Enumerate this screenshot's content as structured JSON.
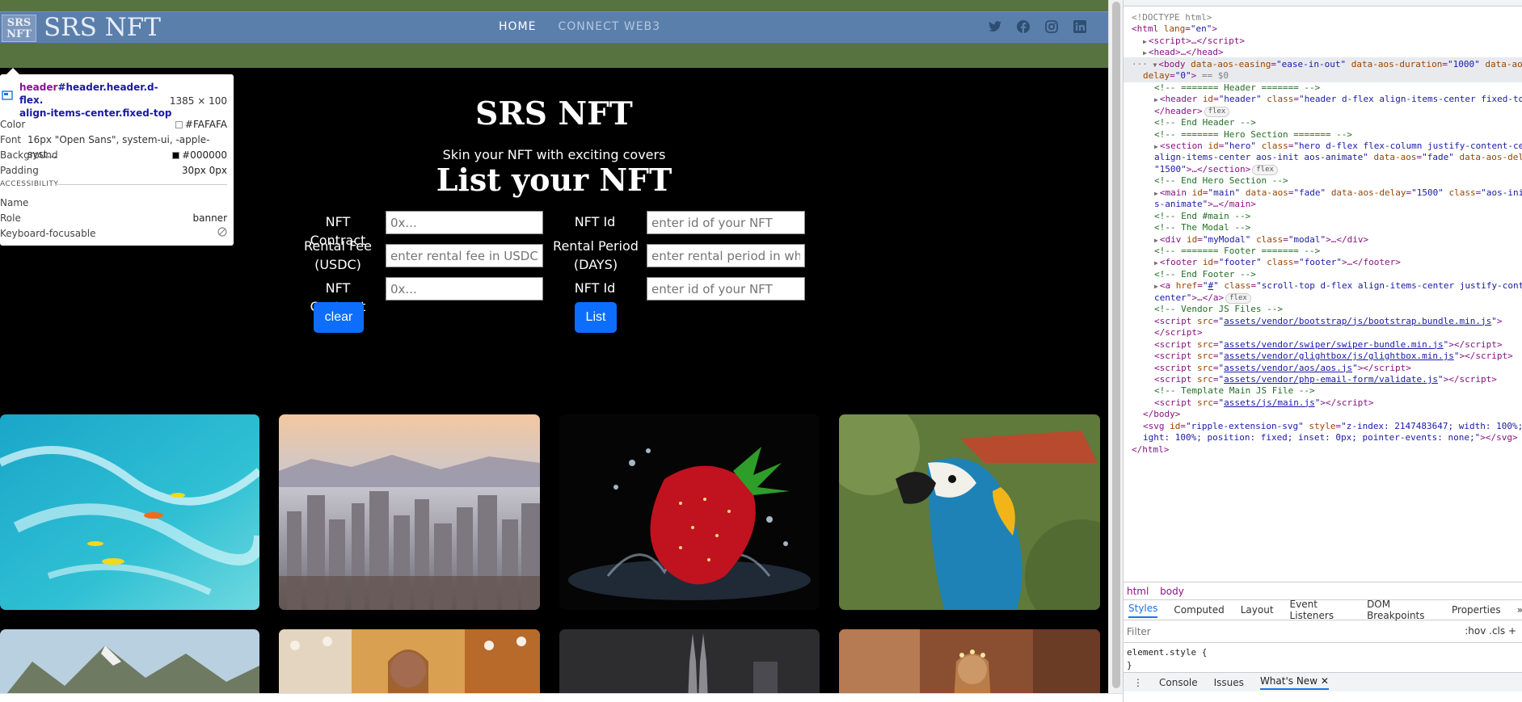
{
  "site": {
    "logo_mark": "SRS NFT",
    "name": "SRS NFT",
    "nav": [
      {
        "label": "HOME",
        "active": true
      },
      {
        "label": "CONNECT WEB3",
        "active": false
      }
    ],
    "socials": [
      "twitter-icon",
      "facebook-icon",
      "instagram-icon",
      "linkedin-icon"
    ]
  },
  "tooltip": {
    "selector_tag": "header",
    "selector_rest": "#header.header.d-flex.",
    "selector_line2": "align-items-center.fixed-top",
    "size": "1385 × 100",
    "rows": [
      {
        "k": "Color",
        "v": "#FAFAFA",
        "swatch": "#fafafa"
      },
      {
        "k": "Font",
        "v": "16px \"Open Sans\", system-ui, -apple-syst…",
        "swatch": ""
      },
      {
        "k": "Background",
        "v": "#000000",
        "swatch": "#000000"
      },
      {
        "k": "Padding",
        "v": "30px 0px",
        "swatch": ""
      }
    ],
    "accessibility_heading": "ACCESSIBILITY",
    "acc_rows": [
      {
        "k": "Name",
        "v": ""
      },
      {
        "k": "Role",
        "v": "banner"
      },
      {
        "k": "Keyboard-focusable",
        "v": ""
      }
    ]
  },
  "hero": {
    "title": "SRS NFT",
    "subtitle": "Skin your NFT with exciting covers",
    "form_title": "List your NFT"
  },
  "form": {
    "label_nft_contract": "NFT Contract",
    "label_nft_id": "NFT Id",
    "label_rental_fee": "Rental Fee (USDC)",
    "label_rental_period": "Rental Period (DAYS)",
    "label_nft_contract_2": "NFT Contract",
    "label_nft_id_2": "NFT Id",
    "placeholder_contract": "0x...",
    "placeholder_id": "enter id of your NFT",
    "placeholder_fee": "enter rental fee in USDC",
    "placeholder_period": "enter rental period in wh",
    "placeholder_contract_2": "0x...",
    "placeholder_id_2": "enter id of your NFT",
    "clear_label": "clear",
    "list_label": "List"
  },
  "gallery": [
    "surfers",
    "city-skyline",
    "strawberry-splash",
    "macaw-parrot",
    "mountains",
    "fashion-model",
    "twin-towers",
    "woman-forest"
  ],
  "devtools": {
    "lines": [
      {
        "i": 0,
        "html": "<span class='t-gray'>&lt;!DOCTYPE html&gt;</span>"
      },
      {
        "i": 0,
        "html": "<span class='t-tag'>&lt;html</span> <span class='t-attr'>lang</span>=<span class='t-val'>\"en\"</span><span class='t-tag'>&gt;</span>"
      },
      {
        "i": 1,
        "html": "<span class='tri'>▶</span><span class='t-tag'>&lt;script&gt;</span>…<span class='t-tag'>&lt;/script&gt;</span>"
      },
      {
        "i": 1,
        "html": "<span class='tri'>▶</span><span class='t-tag'>&lt;head&gt;</span>…<span class='t-tag'>&lt;/head&gt;</span>"
      },
      {
        "i": 0,
        "sel": true,
        "html": "<span class='t-gray'>··· </span><span class='tri'>▼</span><span class='t-tag'>&lt;body</span> <span class='t-attr'>data-aos-easing</span>=<span class='t-val'>\"ease-in-out\"</span> <span class='t-attr'>data-aos-duration</span>=<span class='t-val'>\"1000\"</span> <span class='t-attr'>data-aos-</span>"
      },
      {
        "i": 1,
        "sel": true,
        "html": "<span class='t-attr'>delay</span>=<span class='t-val'>\"0\"</span><span class='t-tag'>&gt;</span> <span class='t-gray'>== $0</span>"
      },
      {
        "i": 2,
        "html": "<span class='t-cmt'>&lt;!-- ======= Header ======= --&gt;</span>"
      },
      {
        "i": 2,
        "html": "<span class='tri'>▶</span><span class='t-tag'>&lt;header</span> <span class='t-attr'>id</span>=<span class='t-val'>\"header\"</span> <span class='t-attr'>class</span>=<span class='t-val'>\"header d-flex align-items-center fixed-top</span>"
      },
      {
        "i": 2,
        "html": "<span class='t-tag'>&lt;/header&gt;</span><span class='badge'>flex</span>"
      },
      {
        "i": 2,
        "html": "<span class='t-cmt'>&lt;!-- End Header --&gt;</span>"
      },
      {
        "i": 2,
        "html": "<span class='t-cmt'>&lt;!-- ======= Hero Section ======= --&gt;</span>"
      },
      {
        "i": 2,
        "html": "<span class='tri'>▶</span><span class='t-tag'>&lt;section</span> <span class='t-attr'>id</span>=<span class='t-val'>\"hero\"</span> <span class='t-attr'>class</span>=<span class='t-val'>\"hero d-flex flex-column justify-content-cen</span>"
      },
      {
        "i": 2,
        "html": "<span class='t-val'>align-items-center aos-init aos-animate\"</span> <span class='t-attr'>data-aos</span>=<span class='t-val'>\"fade\"</span> <span class='t-attr'>data-aos-del</span>"
      },
      {
        "i": 2,
        "html": "<span class='t-val'>\"1500\"</span><span class='t-tag'>&gt;</span>…<span class='t-tag'>&lt;/section&gt;</span><span class='badge'>flex</span>"
      },
      {
        "i": 2,
        "html": "<span class='t-cmt'>&lt;!-- End Hero Section --&gt;</span>"
      },
      {
        "i": 2,
        "html": "<span class='tri'>▶</span><span class='t-tag'>&lt;main</span> <span class='t-attr'>id</span>=<span class='t-val'>\"main\"</span> <span class='t-attr'>data-aos</span>=<span class='t-val'>\"fade\"</span> <span class='t-attr'>data-aos-delay</span>=<span class='t-val'>\"1500\"</span> <span class='t-attr'>class</span>=<span class='t-val'>\"aos-init</span>"
      },
      {
        "i": 2,
        "html": "<span class='t-val'>s-animate\"</span><span class='t-tag'>&gt;</span>…<span class='t-tag'>&lt;/main&gt;</span>"
      },
      {
        "i": 2,
        "html": "<span class='t-cmt'>&lt;!-- End #main --&gt;</span>"
      },
      {
        "i": 2,
        "html": "<span class='t-cmt'>&lt;!-- The Modal --&gt;</span>"
      },
      {
        "i": 2,
        "html": "<span class='tri'>▶</span><span class='t-tag'>&lt;div</span> <span class='t-attr'>id</span>=<span class='t-val'>\"myModal\"</span> <span class='t-attr'>class</span>=<span class='t-val'>\"modal\"</span><span class='t-tag'>&gt;</span>…<span class='t-tag'>&lt;/div&gt;</span>"
      },
      {
        "i": 2,
        "html": "<span class='t-cmt'>&lt;!-- ======= Footer ======= --&gt;</span>"
      },
      {
        "i": 2,
        "html": "<span class='tri'>▶</span><span class='t-tag'>&lt;footer</span> <span class='t-attr'>id</span>=<span class='t-val'>\"footer\"</span> <span class='t-attr'>class</span>=<span class='t-val'>\"footer\"</span><span class='t-tag'>&gt;</span>…<span class='t-tag'>&lt;/footer&gt;</span>"
      },
      {
        "i": 2,
        "html": "<span class='t-cmt'>&lt;!-- End Footer --&gt;</span>"
      },
      {
        "i": 2,
        "html": "<span class='tri'>▶</span><span class='t-tag'>&lt;a</span> <span class='t-attr'>href</span>=<span class='t-val'>\"<span class='t-link'>#</span>\"</span> <span class='t-attr'>class</span>=<span class='t-val'>\"scroll-top d-flex align-items-center justify-conte</span>"
      },
      {
        "i": 2,
        "html": "<span class='t-val'>center\"</span><span class='t-tag'>&gt;</span>…<span class='t-tag'>&lt;/a&gt;</span><span class='badge'>flex</span>"
      },
      {
        "i": 2,
        "html": "<span class='t-cmt'>&lt;!-- Vendor JS Files --&gt;</span>"
      },
      {
        "i": 2,
        "html": "<span class='t-tag'>&lt;script</span> <span class='t-attr'>src</span>=<span class='t-val'>\"<span class='t-link'>assets/vendor/bootstrap/js/bootstrap.bundle.min.js</span>\"</span><span class='t-tag'>&gt;</span>"
      },
      {
        "i": 2,
        "html": "<span class='t-tag'>&lt;/script&gt;</span>"
      },
      {
        "i": 2,
        "html": "<span class='t-tag'>&lt;script</span> <span class='t-attr'>src</span>=<span class='t-val'>\"<span class='t-link'>assets/vendor/swiper/swiper-bundle.min.js</span>\"</span><span class='t-tag'>&gt;&lt;/script&gt;</span>"
      },
      {
        "i": 2,
        "html": "<span class='t-tag'>&lt;script</span> <span class='t-attr'>src</span>=<span class='t-val'>\"<span class='t-link'>assets/vendor/glightbox/js/glightbox.min.js</span>\"</span><span class='t-tag'>&gt;&lt;/script&gt;</span>"
      },
      {
        "i": 2,
        "html": "<span class='t-tag'>&lt;script</span> <span class='t-attr'>src</span>=<span class='t-val'>\"<span class='t-link'>assets/vendor/aos/aos.js</span>\"</span><span class='t-tag'>&gt;&lt;/script&gt;</span>"
      },
      {
        "i": 2,
        "html": "<span class='t-tag'>&lt;script</span> <span class='t-attr'>src</span>=<span class='t-val'>\"<span class='t-link'>assets/vendor/php-email-form/validate.js</span>\"</span><span class='t-tag'>&gt;&lt;/script&gt;</span>"
      },
      {
        "i": 2,
        "html": "<span class='t-cmt'>&lt;!-- Template Main JS File --&gt;</span>"
      },
      {
        "i": 2,
        "html": "<span class='t-tag'>&lt;script</span> <span class='t-attr'>src</span>=<span class='t-val'>\"<span class='t-link'>assets/js/main.js</span>\"</span><span class='t-tag'>&gt;&lt;/script&gt;</span>"
      },
      {
        "i": 1,
        "html": "<span class='t-tag'>&lt;/body&gt;</span>"
      },
      {
        "i": 1,
        "html": "<span class='t-tag'>&lt;svg</span> <span class='t-attr'>id</span>=<span class='t-val'>\"ripple-extension-svg\"</span> <span class='t-attr'>style</span>=<span class='t-val'>\"z-index: 2147483647; width: 100%;</span>"
      },
      {
        "i": 1,
        "html": "<span class='t-val'>ight: 100%; position: fixed; inset: 0px; pointer-events: none;\"</span><span class='t-tag'>&gt;&lt;/svg&gt;</span>"
      },
      {
        "i": 0,
        "html": "<span class='t-tag'>&lt;/html&gt;</span>"
      }
    ],
    "breadcrumbs": [
      "html",
      "body"
    ],
    "tabs": [
      {
        "label": "Styles",
        "active": true
      },
      {
        "label": "Computed",
        "active": false
      },
      {
        "label": "Layout",
        "active": false
      },
      {
        "label": "Event Listeners",
        "active": false
      },
      {
        "label": "DOM Breakpoints",
        "active": false
      },
      {
        "label": "Properties",
        "active": false
      }
    ],
    "more_tabs": "»",
    "filter_placeholder": "Filter",
    "filter_tools": ":hov  .cls  +",
    "style_rule_open": "element.style {",
    "style_rule_close": "}",
    "drawer_tabs": [
      {
        "label": "Console",
        "active": false
      },
      {
        "label": "Issues",
        "active": false
      },
      {
        "label": "What's New",
        "active": true
      }
    ],
    "drawer_menu": "⋮",
    "drawer_close": "✕"
  }
}
